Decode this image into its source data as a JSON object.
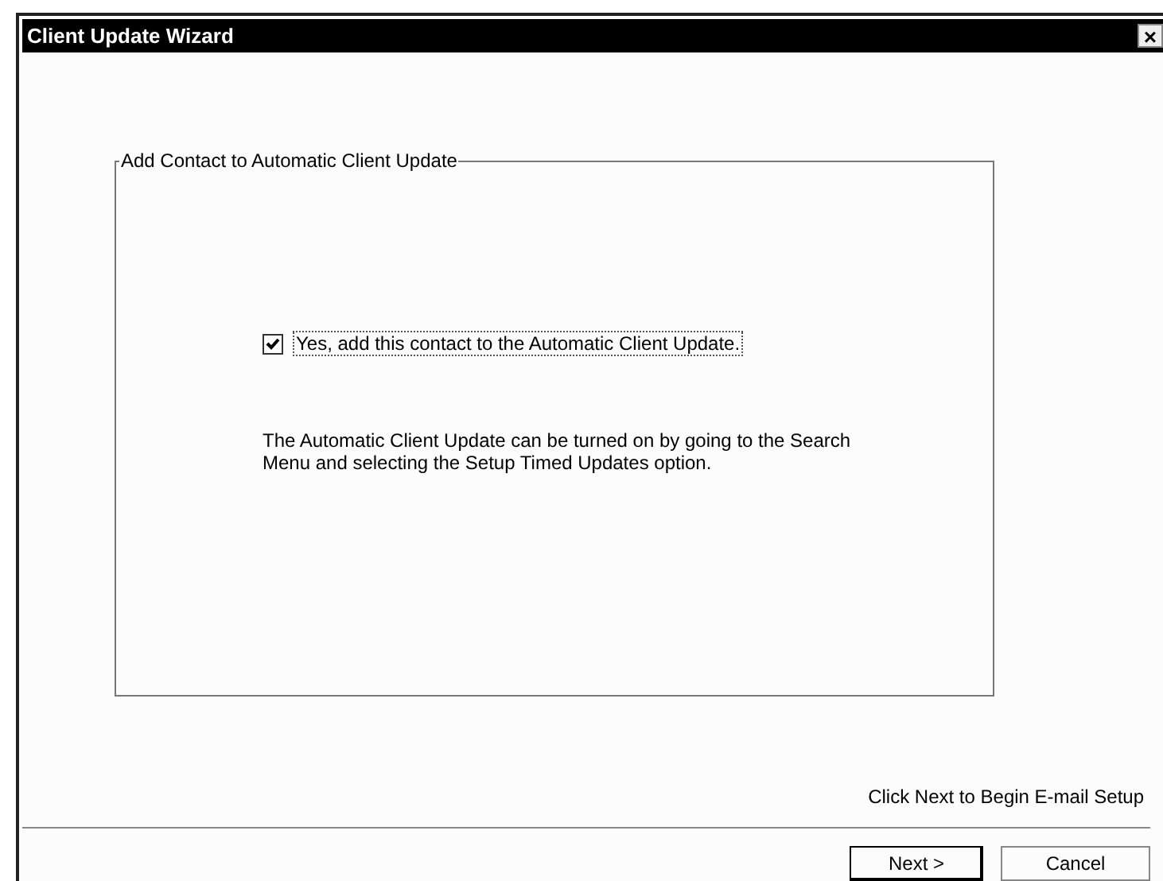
{
  "window": {
    "title": "Client Update Wizard",
    "close": "×"
  },
  "group": {
    "legend": "Add Contact to Automatic Client Update",
    "checkbox": {
      "label": "Yes, add this contact to the Automatic Client Update.",
      "checked": true
    },
    "note": "The Automatic Client Update can be turned on by going to the Search Menu and selecting the Setup Timed Updates option."
  },
  "hint": "Click Next to Begin E-mail Setup",
  "buttons": [
    {
      "label": "Next >",
      "default": true
    },
    {
      "label": "Cancel",
      "default": false
    }
  ]
}
